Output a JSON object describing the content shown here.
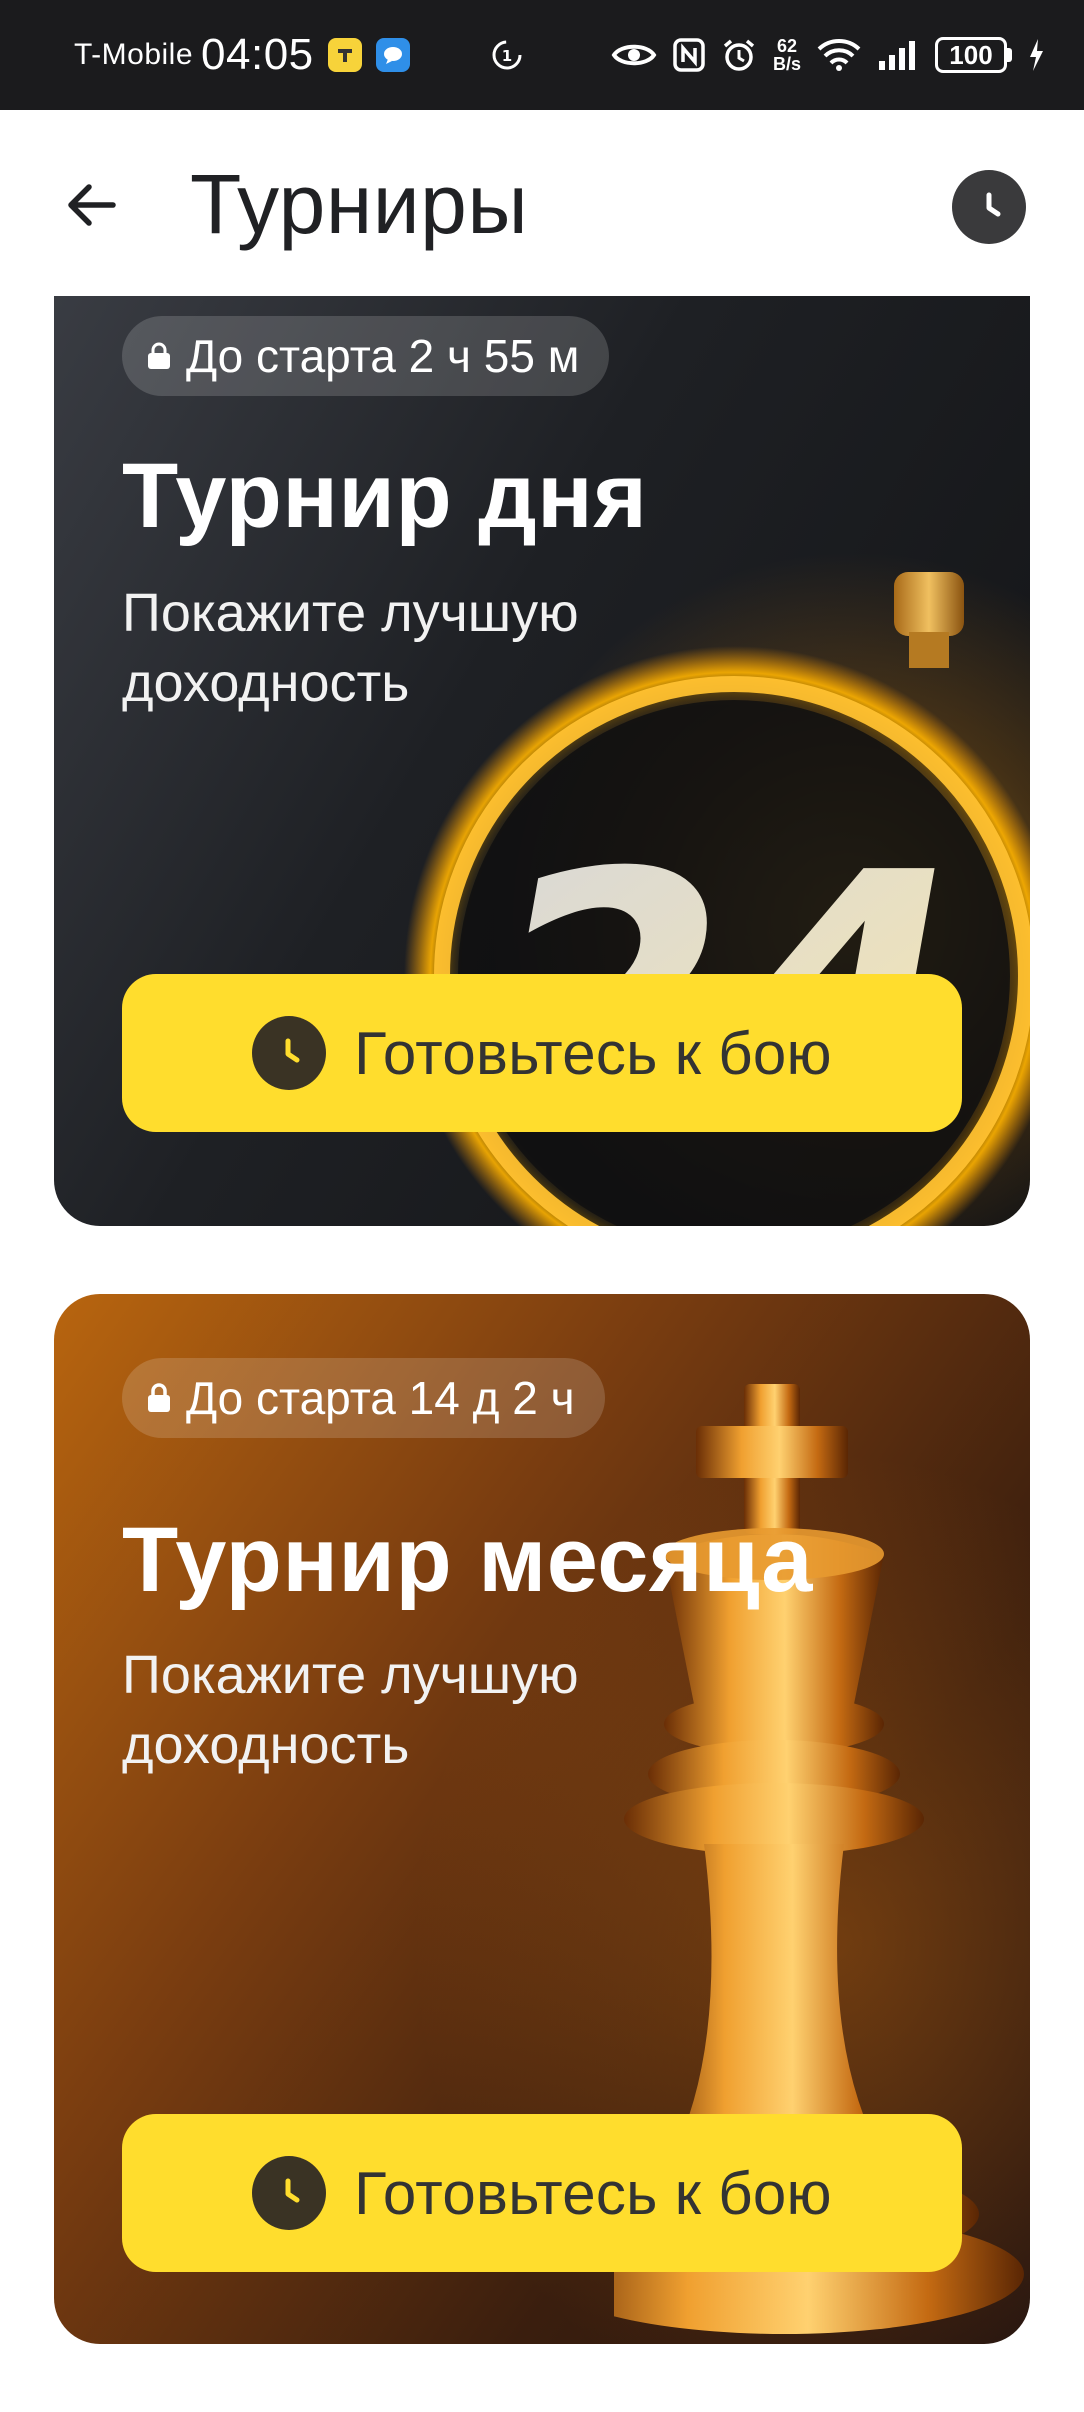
{
  "status_bar": {
    "carrier": "T-Mobile",
    "time": "04:05",
    "net_speed_value": "62",
    "net_speed_unit": "B/s",
    "battery": "100"
  },
  "header": {
    "title": "Турниры",
    "back_icon": "arrow-left-icon",
    "history_icon": "clock-icon"
  },
  "tournaments": [
    {
      "badge": "До старта 2 ч 55 м",
      "title": "Турнир дня",
      "subtitle": "Покажите лучшую доходность",
      "art_text": "24",
      "cta_label": "Готовьтесь к бою",
      "cta_icon": "clock-icon"
    },
    {
      "badge": "До старта 14 д 2 ч",
      "badge_icon": "lock-icon",
      "title": "Турнир месяца",
      "subtitle": "Покажите лучшую доходность",
      "cta_label": "Готовьтесь к бою",
      "cta_icon": "clock-icon"
    }
  ],
  "colors": {
    "cta": "#ffdd2d",
    "status_bar": "#1b1b1d",
    "title": "#202124"
  }
}
